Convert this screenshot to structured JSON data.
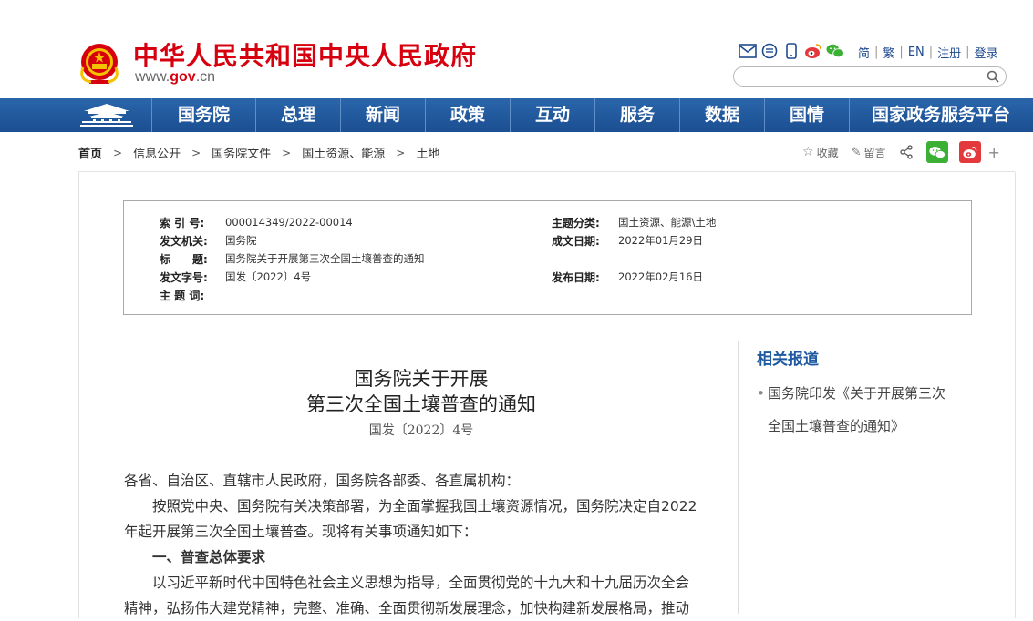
{
  "header": {
    "site_title": "中华人民共和国中央人民政府",
    "domain_prefix": "www.",
    "domain_gov": "gov",
    "domain_suffix": ".cn",
    "top_links": [
      "简",
      "繁",
      "EN",
      "注册",
      "登录"
    ],
    "icons": [
      "mail-icon",
      "chat-bubble-icon",
      "mobile-icon",
      "weibo-icon",
      "wechat-icon"
    ],
    "search_placeholder": ""
  },
  "nav": {
    "items": [
      "国务院",
      "总理",
      "新闻",
      "政策",
      "互动",
      "服务",
      "数据",
      "国情",
      "国家政务服务平台"
    ],
    "colors": {
      "bar": "#1f5aa0",
      "title_red": "#d7000f"
    }
  },
  "breadcrumb": {
    "items": [
      "首页",
      "信息公开",
      "国务院文件",
      "国土资源、能源",
      "土地"
    ]
  },
  "tools": {
    "favorite": "收藏",
    "message": "留言",
    "share_icon": "share-icon",
    "plus": "+"
  },
  "meta": {
    "index_label": "索 引 号:",
    "index_value": "000014349/2022-00014",
    "category_label": "主题分类:",
    "category_value": "国土资源、能源\\土地",
    "issuer_label": "发文机关:",
    "issuer_value": "国务院",
    "date_written_label": "成文日期:",
    "date_written_value": "2022年01月29日",
    "title_label": "标　　题:",
    "title_value": "国务院关于开展第三次全国土壤普查的通知",
    "doc_no_label": "发文字号:",
    "doc_no_value": "国发〔2022〕4号",
    "publish_date_label": "发布日期:",
    "publish_date_value": "2022年02月16日",
    "keywords_label": "主 题 词:",
    "keywords_value": ""
  },
  "article": {
    "title_line1": "国务院关于开展",
    "title_line2": "第三次全国土壤普查的通知",
    "doc_number": "国发〔2022〕4号",
    "salutation": "各省、自治区、直辖市人民政府，国务院各部委、各直属机构：",
    "para1_line1": "按照党中央、国务院有关决策部署，为全面掌握我国土壤资源情况，国务院决定自2022",
    "para1_line2": "年起开展第三次全国土壤普查。现将有关事项通知如下：",
    "heading1": "一、普查总体要求",
    "para2_line1": "以习近平新时代中国特色社会主义思想为指导，全面贯彻党的十九大和十九届历次全会",
    "para2_line2": "精神，弘扬伟大建党精神，完整、准确、全面贯彻新发展理念，加快构建新发展格局，推动"
  },
  "related": {
    "title": "相关报道",
    "items": [
      {
        "line1": "国务院印发《关于开展第三次",
        "line2": "全国土壤普查的通知》"
      }
    ]
  }
}
